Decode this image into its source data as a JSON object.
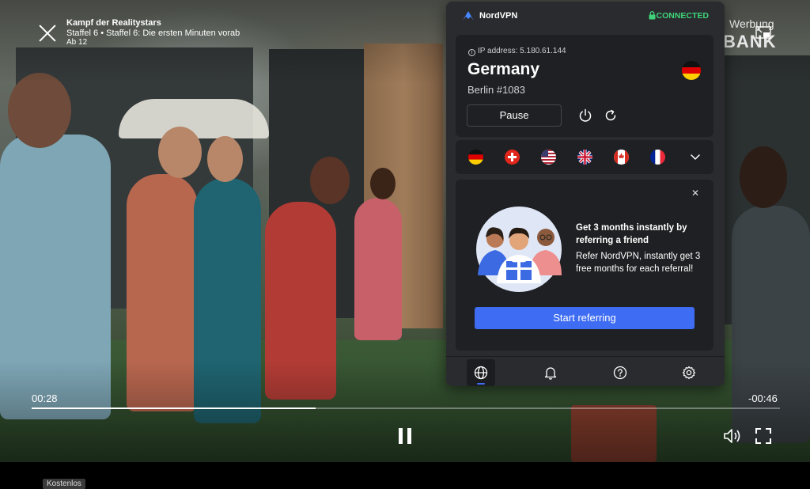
{
  "player": {
    "show_title": "Kampf der Realitystars",
    "episode": "Staffel 6 • Staffel 6: Die ersten Minuten vorab",
    "age_rating": "Ab 12",
    "ad_label": "Werbung",
    "background_sign": "BANK",
    "time_elapsed": "00:28",
    "time_remaining": "-00:46",
    "progress": 0.38,
    "free_badge": "Kostenlos"
  },
  "vpn": {
    "brand": "NordVPN",
    "status": "CONNECTED",
    "status_color": "#3fd47a",
    "ip_label": "IP address: 5.180.61.144",
    "country": "Germany",
    "server": "Berlin #1083",
    "pause_label": "Pause",
    "recent_flags": [
      "germany",
      "switzerland",
      "united-states",
      "united-kingdom",
      "canada",
      "france"
    ],
    "promo": {
      "title": "Get 3 months instantly by referring a friend",
      "body": "Refer NordVPN, instantly get 3 free months for each referral!",
      "cta": "Start referring"
    },
    "accent_color": "#3e6cf2",
    "nav": [
      "globe-icon",
      "bell-icon",
      "help-icon",
      "settings-icon"
    ]
  }
}
